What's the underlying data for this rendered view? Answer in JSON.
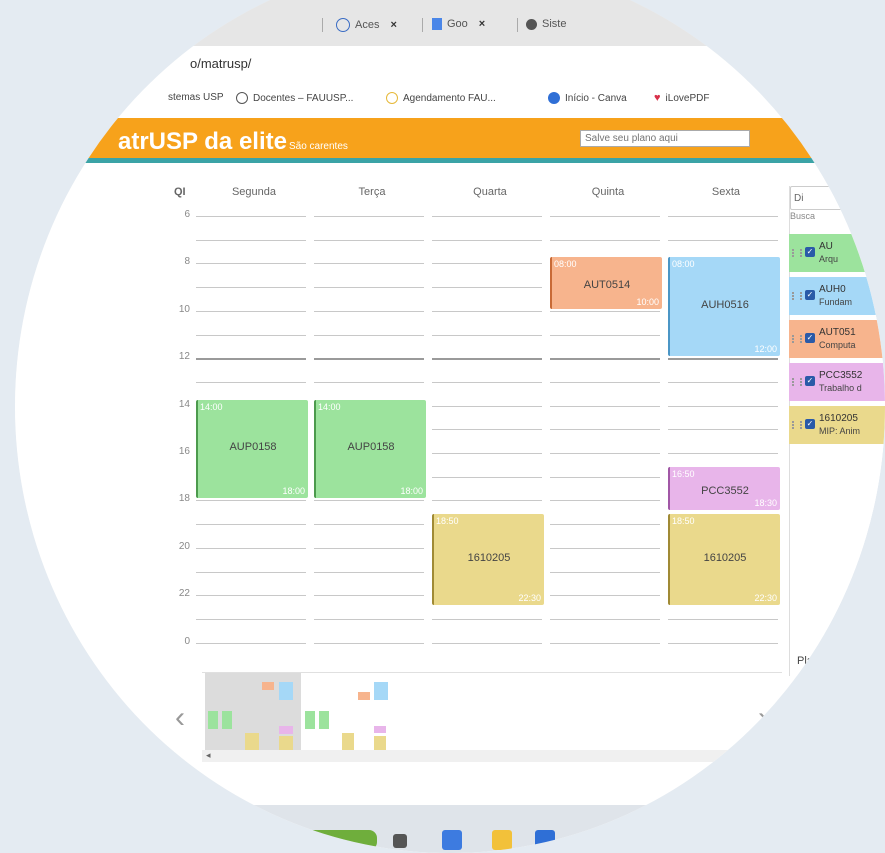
{
  "browser": {
    "tabs": [
      {
        "label": "Aces",
        "close": "×"
      },
      {
        "label": "Goo",
        "close": "×"
      },
      {
        "label": "Siste",
        "close": ""
      }
    ],
    "address": "o/matrusp/",
    "bookmarks": [
      "stemas USP",
      "Docentes – FAUUSP...",
      "Agendamento FAU...",
      "Início - Canva",
      "iLovePDF"
    ]
  },
  "app": {
    "brand": "atrUSP da elite",
    "brand_sub": "São carentes",
    "save_placeholder": "Salve seu plano aqui"
  },
  "calendar": {
    "corner": "QI",
    "days": [
      "Segunda",
      "Terça",
      "Quarta",
      "Quinta",
      "Sexta"
    ],
    "hour_labels": [
      "6",
      "8",
      "10",
      "12",
      "14",
      "16",
      "18",
      "20",
      "22",
      "0"
    ],
    "events": [
      {
        "day": 0,
        "code": "AUP0158",
        "start": "14:00",
        "end": "18:00",
        "color": "green"
      },
      {
        "day": 1,
        "code": "AUP0158",
        "start": "14:00",
        "end": "18:00",
        "color": "green"
      },
      {
        "day": 3,
        "code": "AUT0514",
        "start": "08:00",
        "end": "10:00",
        "color": "orange"
      },
      {
        "day": 4,
        "code": "AUH0516",
        "start": "08:00",
        "end": "12:00",
        "color": "blue"
      },
      {
        "day": 4,
        "code": "PCC3552",
        "start": "16:50",
        "end": "18:30",
        "color": "pink"
      },
      {
        "day": 2,
        "code": "1610205",
        "start": "18:50",
        "end": "22:30",
        "color": "yellow"
      },
      {
        "day": 4,
        "code": "1610205",
        "start": "18:50",
        "end": "22:30",
        "color": "yellow"
      }
    ]
  },
  "panel": {
    "select": "Di",
    "search_label": "Busca",
    "courses": [
      {
        "code": "AU",
        "name": "Arqu",
        "color": "#9ce39d"
      },
      {
        "code": "AUH0",
        "name": "Fundam",
        "color": "#a5d8f7"
      },
      {
        "code": "AUT051",
        "name": "Computa",
        "color": "#f7b48d"
      },
      {
        "code": "PCC3552",
        "name": "Trabalho d",
        "color": "#e8b5ea"
      },
      {
        "code": "1610205",
        "name": "MIP: Anim",
        "color": "#ead98c"
      }
    ],
    "planos": "Pla"
  },
  "nav": {
    "prev": "‹",
    "next": "›",
    "scroll_arrow": "◂"
  },
  "colors": {
    "header": "#f7a21b",
    "header_line": "#3ba3a6",
    "green": "#9ce39d",
    "orange": "#f7b48d",
    "blue": "#a5d8f7",
    "pink": "#e8b5ea",
    "yellow": "#ead98c"
  }
}
